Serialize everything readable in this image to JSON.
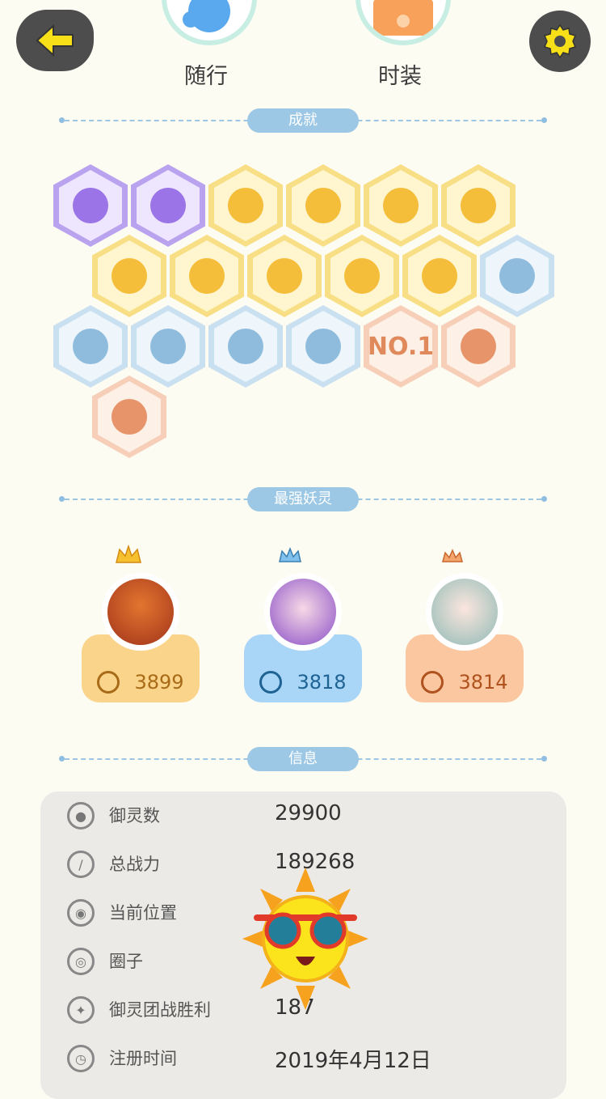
{
  "top_nav": {
    "companion_label": "随行",
    "fashion_label": "时装"
  },
  "sections": {
    "achievements": "成就",
    "strongest_spirits": "最强妖灵",
    "info": "信息"
  },
  "achievement_badges": {
    "no1_text": "NO.1"
  },
  "spirits": [
    {
      "power": "3899",
      "color": "#fbd48b"
    },
    {
      "power": "3818",
      "color": "#a9d5f6"
    },
    {
      "power": "3814",
      "color": "#fbc7a0"
    }
  ],
  "info": {
    "rows": [
      {
        "label": "御灵数",
        "value": "29900",
        "icon": "spirit-icon"
      },
      {
        "label": "总战力",
        "value": "189268",
        "icon": "sword-icon"
      },
      {
        "label": "当前位置",
        "value": "",
        "icon": "location-icon"
      },
      {
        "label": "圈子",
        "value": "",
        "icon": "circle-icon"
      },
      {
        "label": "御灵团战胜利",
        "value": "187",
        "icon": "team-icon"
      },
      {
        "label": "注册时间",
        "value": "2019年4月12日",
        "icon": "clock-icon"
      }
    ]
  },
  "colors": {
    "background": "#fdfcf3",
    "section_pill": "#9cc8e5",
    "top_button": "#4d4d4d",
    "accent_yellow": "#f5d520"
  }
}
